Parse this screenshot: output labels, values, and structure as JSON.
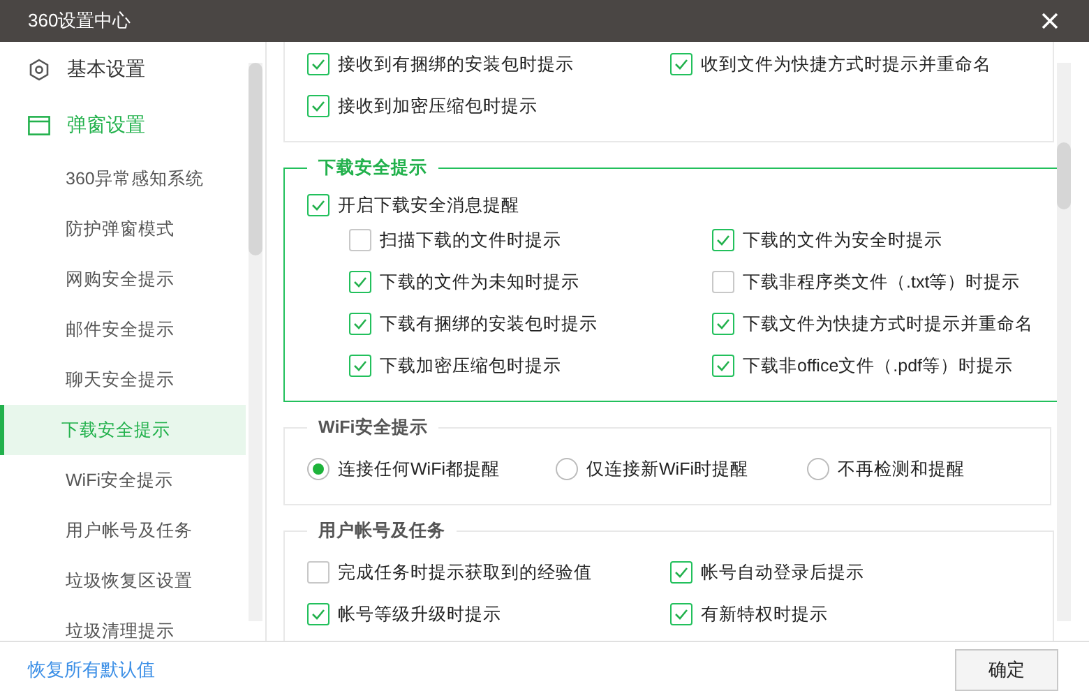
{
  "window": {
    "title": "360设置中心"
  },
  "sidebar": {
    "categories": [
      {
        "label": "基本设置",
        "selected": false
      },
      {
        "label": "弹窗设置",
        "selected": true,
        "children": [
          {
            "label": "360异常感知系统",
            "selected": false
          },
          {
            "label": "防护弹窗模式",
            "selected": false
          },
          {
            "label": "网购安全提示",
            "selected": false
          },
          {
            "label": "邮件安全提示",
            "selected": false
          },
          {
            "label": "聊天安全提示",
            "selected": false
          },
          {
            "label": "下载安全提示",
            "selected": true
          },
          {
            "label": "WiFi安全提示",
            "selected": false
          },
          {
            "label": "用户帐号及任务",
            "selected": false
          },
          {
            "label": "垃圾恢复区设置",
            "selected": false
          },
          {
            "label": "垃圾清理提示",
            "selected": false
          }
        ]
      }
    ]
  },
  "sections": [
    {
      "kind": "checkboxes",
      "active": false,
      "options": [
        {
          "label": "接收到有捆绑的安装包时提示",
          "checked": true
        },
        {
          "label": "收到文件为快捷方式时提示并重命名",
          "checked": true
        },
        {
          "label": "接收到加密压缩包时提示",
          "checked": true
        }
      ]
    },
    {
      "kind": "checkboxes",
      "title": "下载安全提示",
      "active": true,
      "master": {
        "label": "开启下载安全消息提醒",
        "checked": true
      },
      "options": [
        {
          "label": "扫描下载的文件时提示",
          "checked": false
        },
        {
          "label": "下载的文件为安全时提示",
          "checked": true
        },
        {
          "label": "下载的文件为未知时提示",
          "checked": true
        },
        {
          "label": "下载非程序类文件（.txt等）时提示",
          "checked": false
        },
        {
          "label": "下载有捆绑的安装包时提示",
          "checked": true
        },
        {
          "label": "下载文件为快捷方式时提示并重命名",
          "checked": true
        },
        {
          "label": "下载加密压缩包时提示",
          "checked": true
        },
        {
          "label": "下载非office文件（.pdf等）时提示",
          "checked": true
        }
      ]
    },
    {
      "kind": "radios",
      "title": "WiFi安全提示",
      "active": false,
      "options": [
        {
          "label": "连接任何WiFi都提醒",
          "selected": true
        },
        {
          "label": "仅连接新WiFi时提醒",
          "selected": false
        },
        {
          "label": "不再检测和提醒",
          "selected": false
        }
      ]
    },
    {
      "kind": "checkboxes",
      "title": "用户帐号及任务",
      "active": false,
      "options": [
        {
          "label": "完成任务时提示获取到的经验值",
          "checked": false
        },
        {
          "label": "帐号自动登录后提示",
          "checked": true
        },
        {
          "label": "帐号等级升级时提示",
          "checked": true
        },
        {
          "label": "有新特权时提示",
          "checked": true
        }
      ]
    }
  ],
  "footer": {
    "reset_link": "恢复所有默认值",
    "ok_button": "确定"
  }
}
